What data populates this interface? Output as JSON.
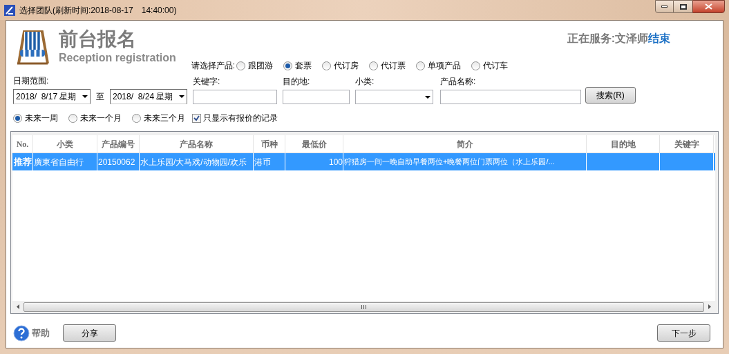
{
  "window": {
    "title": "选择团队(刷新时间:2018-08-17　14:40:00)"
  },
  "header": {
    "title": "前台报名",
    "subtitle": "Reception registration",
    "service_label": "正在服务:文泽师",
    "end_link": "结束"
  },
  "product_selector": {
    "label": "请选择产品:",
    "options": [
      {
        "label": "跟团游",
        "selected": false
      },
      {
        "label": "套票",
        "selected": true
      },
      {
        "label": "代订房",
        "selected": false
      },
      {
        "label": "代订票",
        "selected": false
      },
      {
        "label": "单项产品",
        "selected": false
      },
      {
        "label": "代订车",
        "selected": false
      }
    ]
  },
  "filters": {
    "date_range_label": "日期范围:",
    "date_from": "2018/  8/17 星期",
    "to_label": "至",
    "date_to": "2018/  8/24 星期",
    "keyword_label": "关键字:",
    "destination_label": "目的地:",
    "category_label": "小类:",
    "product_name_label": "产品名称:",
    "search_button": "搜索(R)"
  },
  "periods": [
    {
      "label": "未来一周",
      "selected": true
    },
    {
      "label": "未来一个月",
      "selected": false
    },
    {
      "label": "未来三个月",
      "selected": false
    }
  ],
  "quoted_only": {
    "label": "只显示有报价的记录",
    "checked": true
  },
  "table": {
    "columns": [
      "No.",
      "小类",
      "产品编号",
      "产品名称",
      "币种",
      "最低价",
      "简介",
      "目的地",
      "关键字"
    ],
    "rows": [
      {
        "selected": true,
        "cells": [
          "推荐",
          "廣東省自由行",
          "20150062",
          "水上乐园/大马戏/动物园/欢乐",
          "港币",
          "100",
          "狩猎房一间一晚自助早餐两位+晚餐两位门票两位（水上乐园/...",
          "",
          ""
        ]
      }
    ]
  },
  "footer": {
    "help": "帮助",
    "share_button": "分享",
    "next_button": "下一步"
  }
}
